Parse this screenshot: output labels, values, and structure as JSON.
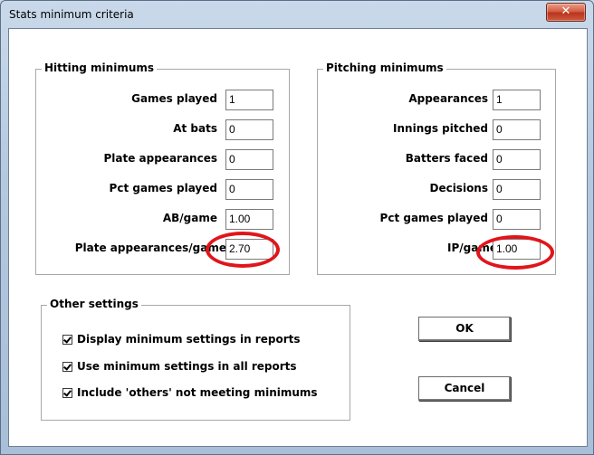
{
  "window": {
    "title": "Stats minimum criteria",
    "close_glyph": "✕"
  },
  "hitting": {
    "title": "Hitting minimums",
    "fields": [
      {
        "label": "Games played",
        "value": "1"
      },
      {
        "label": "At bats",
        "value": "0"
      },
      {
        "label": "Plate appearances",
        "value": "0"
      },
      {
        "label": "Pct games played",
        "value": "0"
      },
      {
        "label": "AB/game",
        "value": "1.00"
      },
      {
        "label": "Plate appearances/game",
        "value": "2.70"
      }
    ]
  },
  "pitching": {
    "title": "Pitching minimums",
    "fields": [
      {
        "label": "Appearances",
        "value": "1"
      },
      {
        "label": "Innings pitched",
        "value": "0"
      },
      {
        "label": "Batters faced",
        "value": "0"
      },
      {
        "label": "Decisions",
        "value": "0"
      },
      {
        "label": "Pct games played",
        "value": "0"
      },
      {
        "label": "IP/game",
        "value": "1.00"
      }
    ]
  },
  "other": {
    "title": "Other settings",
    "options": [
      {
        "label": "Display minimum settings in reports",
        "checked": true
      },
      {
        "label": "Use minimum settings in all reports",
        "checked": true
      },
      {
        "label": "Include 'others' not meeting minimums",
        "checked": true
      }
    ]
  },
  "buttons": {
    "ok": "OK",
    "cancel": "Cancel"
  },
  "annotation_color": "#e0151b"
}
